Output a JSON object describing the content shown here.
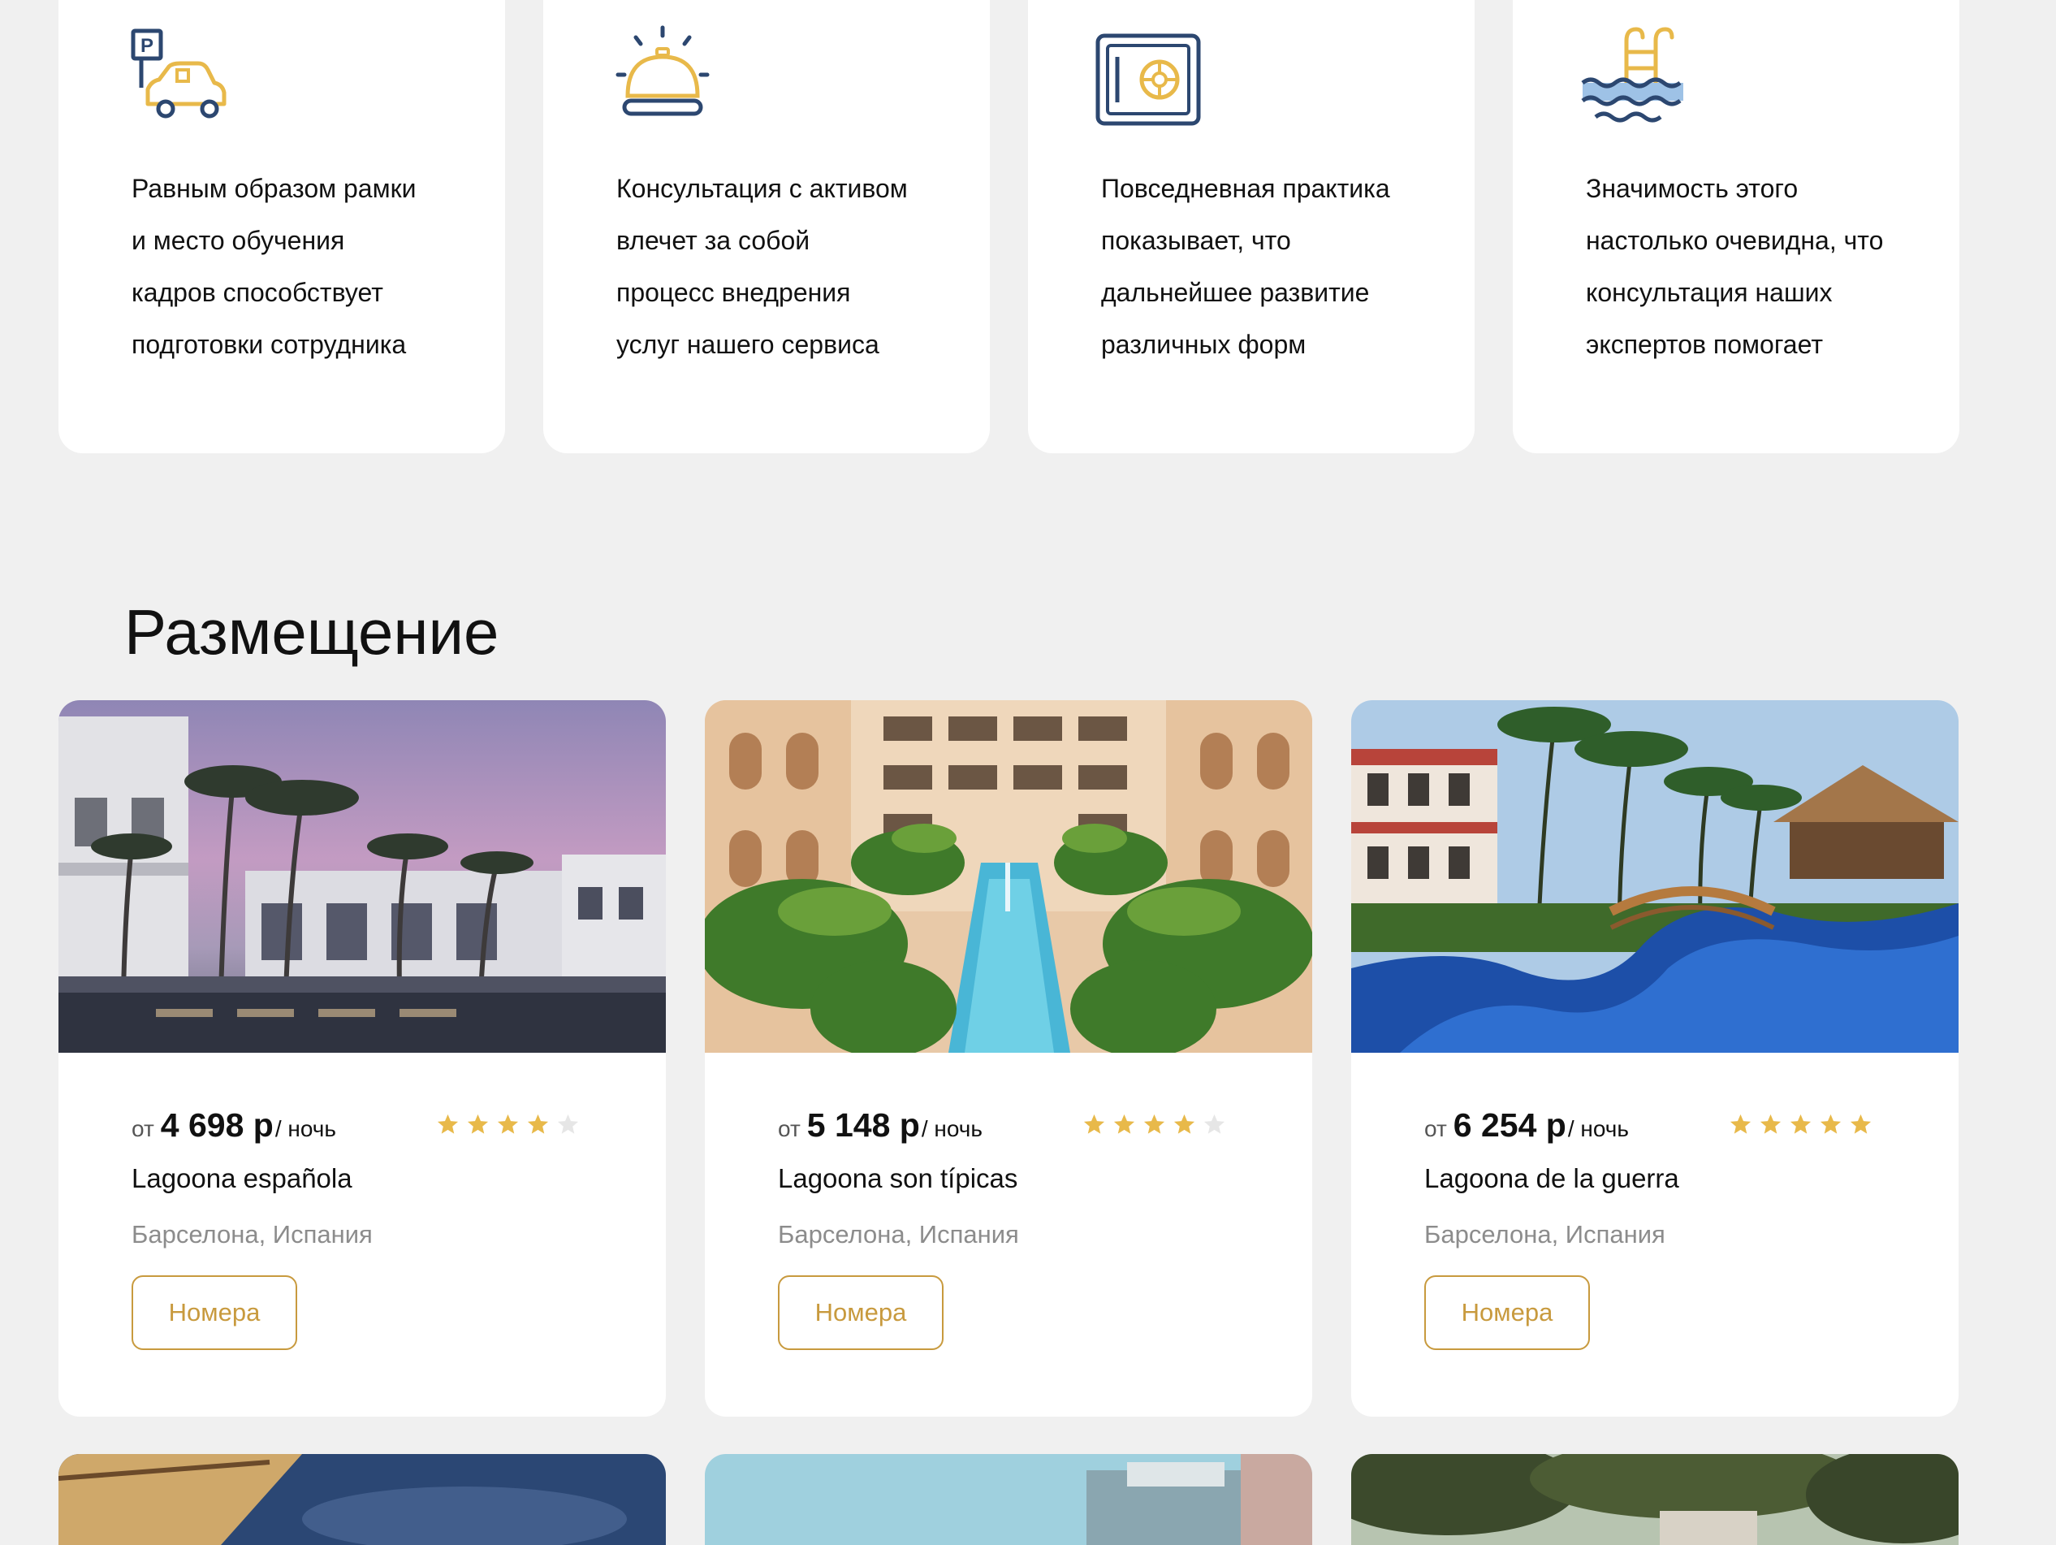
{
  "features": [
    {
      "icon": "parking-car-icon",
      "text": [
        "Равным образом рамки",
        "и место обучения",
        "кадров способствует",
        "подготовки сотрудника"
      ]
    },
    {
      "icon": "reception-bell-icon",
      "text": [
        "Консультация с активом",
        "влечет за собой",
        "процесс внедрения",
        "услуг нашего сервиса"
      ]
    },
    {
      "icon": "safe-icon",
      "text": [
        "Повседневная практика",
        "показывает, что",
        "дальнейшее развитие",
        "различных форм"
      ]
    },
    {
      "icon": "pool-ladder-icon",
      "text": [
        "Значимость этого",
        "настолько очевидна, что",
        "консультация наших",
        "экспертов помогает"
      ]
    }
  ],
  "section": {
    "title": "Размещение"
  },
  "hotels": [
    {
      "price_from": "от",
      "price": "4 698 р",
      "price_unit": "/ ночь",
      "rating": 4,
      "name": "Lagoona española",
      "location": "Барселона, Испания",
      "button": "Номера",
      "photo": "sunset-resort-photo"
    },
    {
      "price_from": "от",
      "price": "5 148 р",
      "price_unit": "/ ночь",
      "rating": 4,
      "name": "Lagoona son típicas",
      "location": "Барселона, Испания",
      "button": "Номера",
      "photo": "courtyard-pool-photo"
    },
    {
      "price_from": "от",
      "price": "6 254 р",
      "price_unit": "/ ночь",
      "rating": 5,
      "name": "Lagoona de la guerra",
      "location": "Барселона, Испания",
      "button": "Номера",
      "photo": "lagoon-pool-photo"
    }
  ],
  "colors": {
    "accent": "#c89a3e",
    "star": "#e8b94a",
    "star_empty": "#e6e6e6",
    "icon_navy": "#2c4770",
    "icon_gold": "#e8b94a"
  }
}
